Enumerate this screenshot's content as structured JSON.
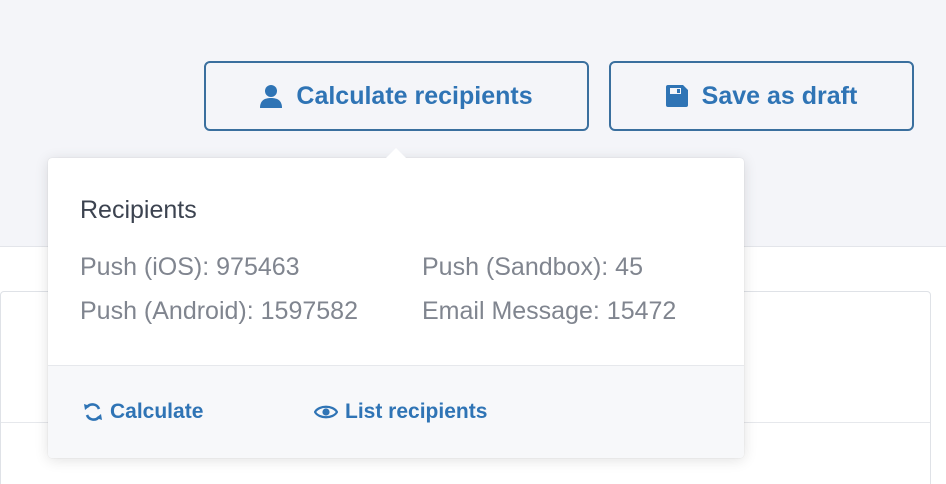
{
  "toolbar": {
    "calculate_recipients_label": "Calculate recipients",
    "save_draft_label": "Save as draft"
  },
  "popover": {
    "title": "Recipients",
    "stats": [
      {
        "label": "Push (iOS)",
        "value": 975463,
        "text": "Push (iOS): 975463"
      },
      {
        "label": "Push (Sandbox)",
        "value": 45,
        "text": "Push (Sandbox): 45"
      },
      {
        "label": "Push (Android)",
        "value": 1597582,
        "text": "Push (Android): 1597582"
      },
      {
        "label": "Email Message",
        "value": 15472,
        "text": "Email Message: 15472"
      }
    ],
    "footer": {
      "calculate_label": "Calculate",
      "list_recipients_label": "List recipients"
    }
  },
  "icons": {
    "calculate_recipients": "user-icon",
    "save_draft": "floppy-disk-icon",
    "calculate": "refresh-icon",
    "list_recipients": "eye-icon"
  },
  "colors": {
    "accent": "#2f74b5",
    "button_border": "#3a6f9e",
    "background": "#f4f5f9",
    "muted_text": "#80858f",
    "title_text": "#3c4350"
  }
}
